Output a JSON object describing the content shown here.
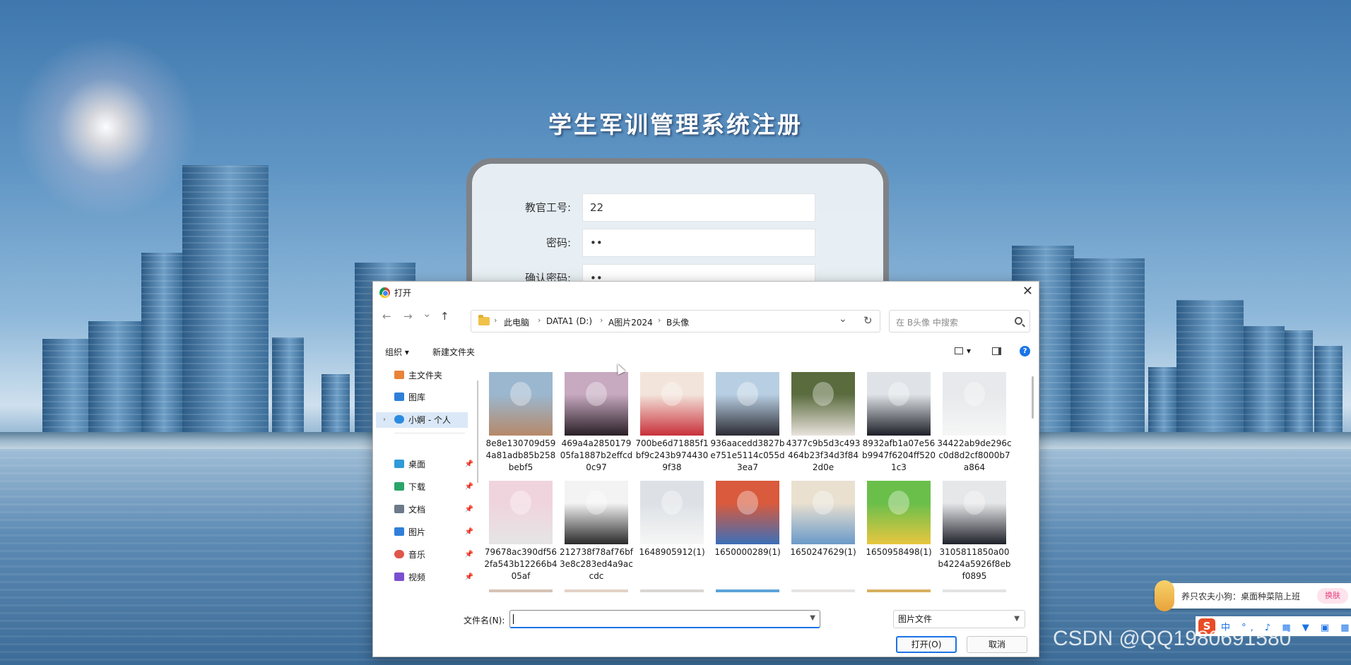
{
  "registration": {
    "title": "学生军训管理系统注册",
    "fields": [
      {
        "label": "教官工号:",
        "value": "22"
      },
      {
        "label": "密码:",
        "value": "••"
      },
      {
        "label": "确认密码:",
        "value": "••"
      }
    ]
  },
  "dialog": {
    "title": "打开",
    "close_glyph": "✕",
    "nav": {
      "back": "←",
      "forward": "→",
      "recent": "⌄",
      "up": "↑",
      "dropdown": "⌄",
      "refresh": "↻"
    },
    "breadcrumb": [
      "此电脑",
      "DATA1 (D:)",
      "A图片2024",
      "B头像"
    ],
    "breadcrumb_sep": "›",
    "search_placeholder": "在 B头像 中搜索",
    "toolbar": {
      "organize": "组织 ▾",
      "new_folder": "新建文件夹",
      "view_arrow": "▾",
      "help": "?"
    },
    "sidebar": [
      {
        "label": "主文件夹",
        "icon": "home-icon",
        "color": "#e8843a"
      },
      {
        "label": "图库",
        "icon": "gallery-icon",
        "color": "#2f7fd9"
      },
      {
        "label": "小婀 - 个人",
        "icon": "onedrive-icon",
        "color": "#2b8be0"
      },
      {
        "label": "桌面",
        "icon": "desktop-icon",
        "color": "#2f9bd9",
        "pin": "📌"
      },
      {
        "label": "下载",
        "icon": "download-icon",
        "color": "#2aa56a",
        "pin": "📌"
      },
      {
        "label": "文档",
        "icon": "documents-icon",
        "color": "#6c7a8a",
        "pin": "📌"
      },
      {
        "label": "图片",
        "icon": "pictures-icon",
        "color": "#2f7fd9",
        "pin": "📌"
      },
      {
        "label": "音乐",
        "icon": "music-icon",
        "color": "#e0574a",
        "pin": "📌"
      },
      {
        "label": "视频",
        "icon": "videos-icon",
        "color": "#7b4fd0",
        "pin": "📌"
      }
    ],
    "files": [
      {
        "name": "8e8e130709d594a81adb85b258bebf5",
        "colors": [
          "#9bb7cf",
          "#b6896a"
        ]
      },
      {
        "name": "469a4a285017905fa1887b2effcd0c97",
        "colors": [
          "#c7a9c0",
          "#2a1f26"
        ]
      },
      {
        "name": "700be6d71885f1bf9c243b9744309f38",
        "colors": [
          "#f3e4db",
          "#c9303a"
        ]
      },
      {
        "name": "936aacedd3827be751e5114c055d3ea7",
        "colors": [
          "#b8cfe3",
          "#2b2b33"
        ]
      },
      {
        "name": "4377c9b5d3c493464b23f34d3f842d0e",
        "colors": [
          "#5a6b3e",
          "#e8e2dc"
        ]
      },
      {
        "name": "8932afb1a07e56b9947f6204ff5201c3",
        "colors": [
          "#dfe3e7",
          "#1d1f28"
        ]
      },
      {
        "name": "34422ab9de296cc0d8d2cf8000b7a864",
        "colors": [
          "#e7e9ec",
          "#f6f6f6"
        ]
      },
      {
        "name": "79678ac390df562fa543b12266b405af",
        "colors": [
          "#f0d4dd",
          "#e5e5e5"
        ]
      },
      {
        "name": "212738f78af76bf3e8c283ed4a9accdc",
        "colors": [
          "#f3f3f3",
          "#2a2a2a"
        ]
      },
      {
        "name": "1648905912(1)",
        "colors": [
          "#dde1e6",
          "#f6f6f6"
        ]
      },
      {
        "name": "1650000289(1)",
        "colors": [
          "#d95a3c",
          "#3b6fb8"
        ]
      },
      {
        "name": "1650247629(1)",
        "colors": [
          "#e9e0d0",
          "#6a9ac9"
        ]
      },
      {
        "name": "1650958498(1)",
        "colors": [
          "#6abf4b",
          "#e8c640"
        ]
      },
      {
        "name": "3105811850a00b4224a5926f8ebf0895",
        "colors": [
          "#e6e7e9",
          "#20222b"
        ]
      },
      {
        "name": "",
        "colors": [
          "#d7c2b4",
          "#3a2a22"
        ]
      },
      {
        "name": "",
        "colors": [
          "#e3d2c6",
          "#3b2c25"
        ]
      },
      {
        "name": "",
        "colors": [
          "#d9d6d3",
          "#5a4a40"
        ]
      },
      {
        "name": "",
        "colors": [
          "#5ca3d8",
          "#f2e2d6"
        ]
      },
      {
        "name": "",
        "colors": [
          "#e6e4e2",
          "#3a2c28"
        ]
      },
      {
        "name": "",
        "colors": [
          "#d8b060",
          "#e8d3a8"
        ]
      },
      {
        "name": "",
        "colors": [
          "#e3e3e3",
          "#2a2a2a"
        ]
      }
    ],
    "filename_label": "文件名(N):",
    "filename_value": "",
    "filetype": "图片文件",
    "open_button": "打开(O)",
    "cancel_button": "取消"
  },
  "notification": {
    "text": "养只农夫小狗：桌面种菜陪上班",
    "button": "换肤"
  },
  "ime": {
    "logo": "S",
    "items": "中 °, ♪ ▦ ▼ ▣ ▦"
  },
  "watermark": "CSDN @QQ1980691580"
}
